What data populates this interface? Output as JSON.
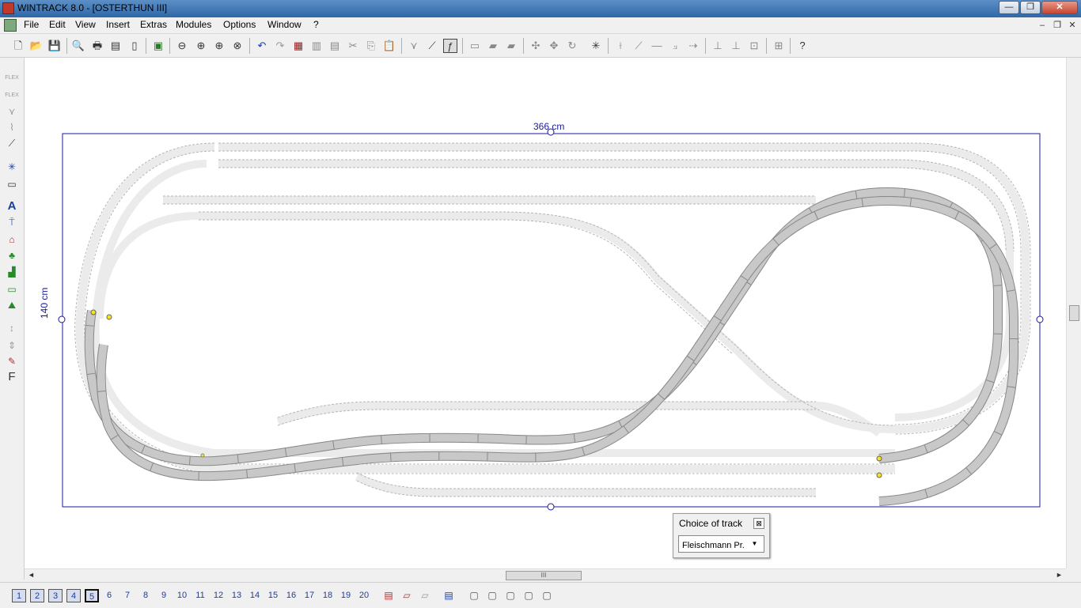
{
  "window": {
    "title": "WINTRACK 8.0 - [OSTERTHUN III]",
    "minimize": "—",
    "restore": "❐",
    "close": "✕"
  },
  "menu": {
    "items": [
      "File",
      "Edit",
      "View",
      "Insert",
      "Extras",
      "Modules",
      "Options",
      "Window",
      "?"
    ],
    "mdi_minimize": "–",
    "mdi_restore": "❐",
    "mdi_close": "✕"
  },
  "toolbar": {
    "icons": [
      "new-document-icon",
      "open-folder-icon",
      "save-icon",
      "print-preview-icon",
      "print-icon",
      "print-setup-icon",
      "page-icon",
      "picture-icon",
      "zoom-out-icon",
      "zoom-in-icon",
      "zoom-window-icon",
      "zoom-fit-icon",
      "undo-icon",
      "redo-icon",
      "parts-list-icon",
      "copy-page-icon",
      "paste-page-icon",
      "cut-icon",
      "copy-icon",
      "paste-icon",
      "track-switch-icon",
      "curve-icon",
      "flex-track-icon",
      "layer-icon",
      "stack-icon",
      "stack2-icon",
      "rotate-icon",
      "move-icon",
      "rotate-180-icon",
      "insert-icon",
      "split-icon",
      "join-icon",
      "straight-icon",
      "branch-icon",
      "arrow-icon",
      "align-left-icon",
      "align-right-icon",
      "align-icon",
      "grid-icon",
      "help-icon"
    ]
  },
  "left_toolbar": {
    "icons": [
      "flex-track-icon",
      "flex-track-icon",
      "turnout-icon",
      "bridge-icon",
      "track-tool-icon",
      "insert-track-icon",
      "table-icon",
      "text-icon",
      "signal-icon",
      "building-icon",
      "tree-icon",
      "stairs-icon",
      "landscape-icon",
      "mountain-icon",
      "height-icon",
      "height2-icon",
      "catenary-icon",
      "font-icon"
    ],
    "text_icon": "A",
    "font_icon": "F"
  },
  "canvas": {
    "width_label": "366 cm",
    "height_label": "140 cm",
    "board_border": "#1a1aa0",
    "track_color": "#c8c8c8",
    "ghost_track_color": "#ebebeb"
  },
  "dialog": {
    "title": "Choice of track",
    "close": "⊠",
    "select_value": "Fleischmann Pr..."
  },
  "hscroll": {
    "grip": "III",
    "left": "◄",
    "right": "►"
  },
  "bottom": {
    "layers": [
      "1",
      "2",
      "3",
      "4",
      "5",
      "6",
      "7",
      "8",
      "9",
      "10",
      "11",
      "12",
      "13",
      "14",
      "15",
      "16",
      "17",
      "18",
      "19",
      "20"
    ],
    "active_layer": "5"
  }
}
